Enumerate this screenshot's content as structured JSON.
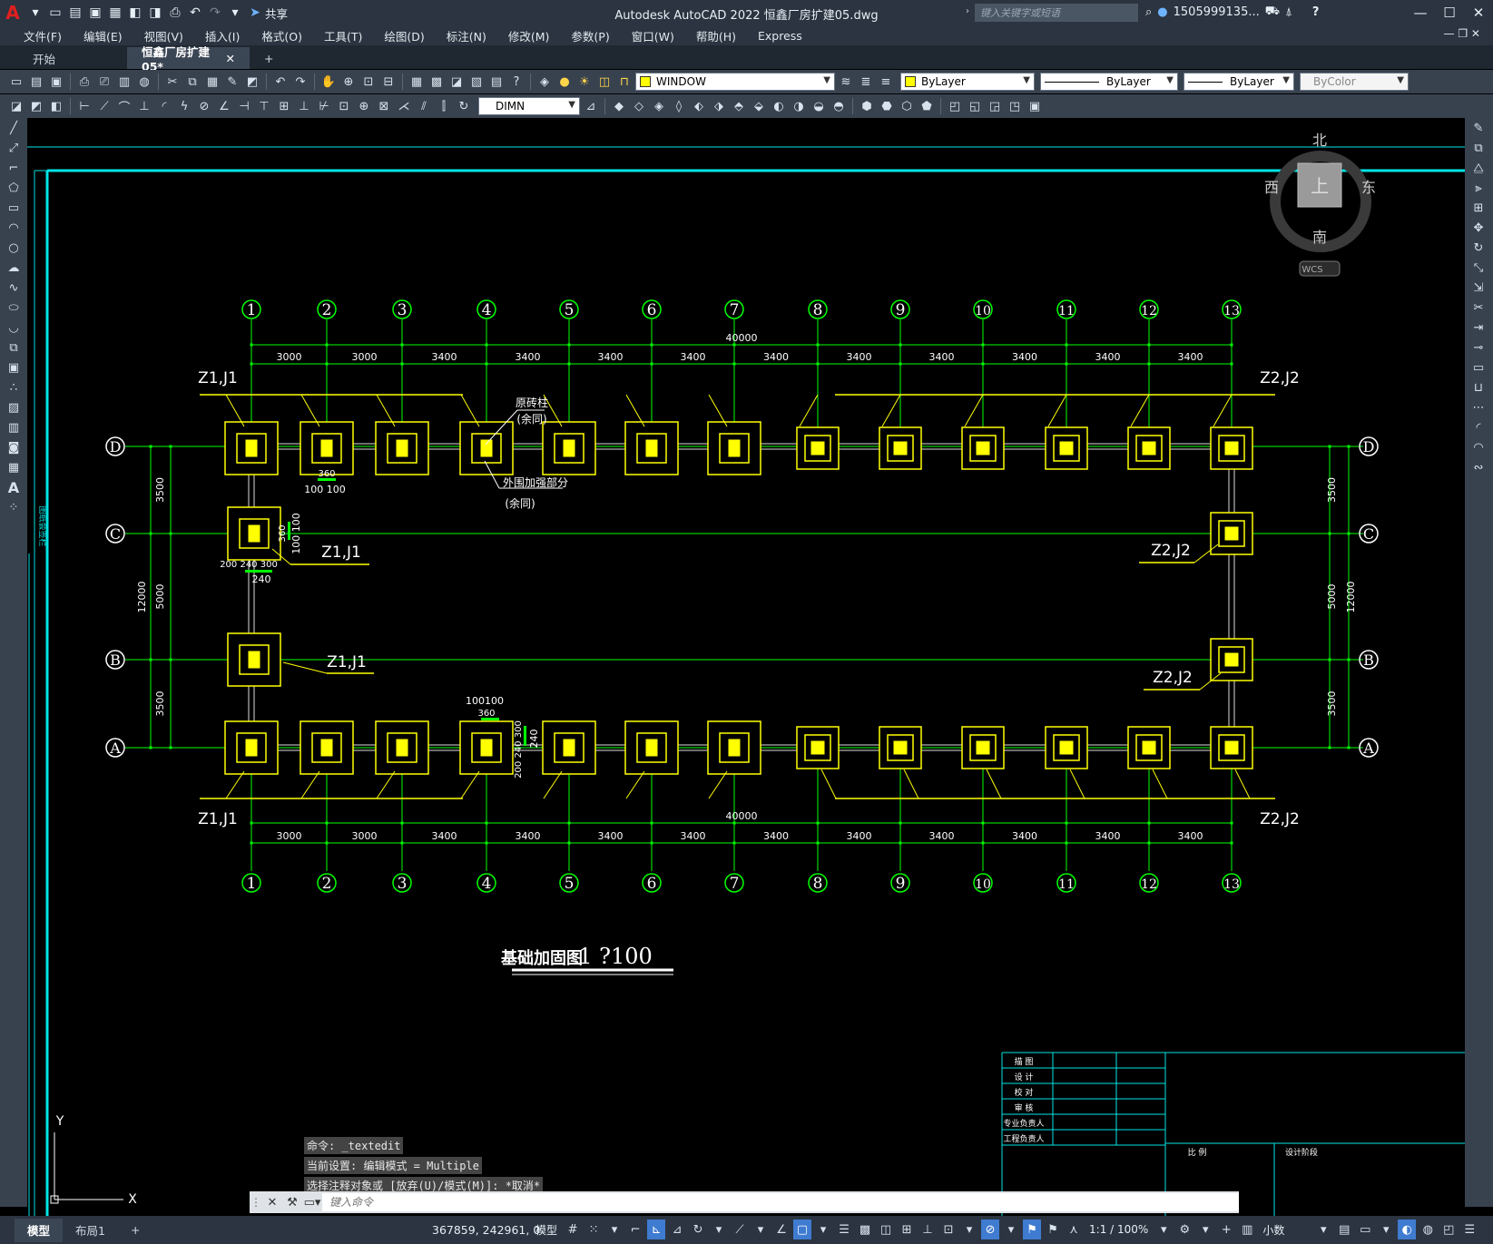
{
  "app": {
    "logo": "A",
    "title": "Autodesk AutoCAD 2022    恒鑫厂房扩建05.dwg",
    "share_label": "共享",
    "search_placeholder": "键入关键字或短语",
    "user": "1505999135...",
    "help": "?"
  },
  "menu": [
    "文件(F)",
    "编辑(E)",
    "视图(V)",
    "插入(I)",
    "格式(O)",
    "工具(T)",
    "绘图(D)",
    "标注(N)",
    "修改(M)",
    "参数(P)",
    "窗口(W)",
    "帮助(H)",
    "Express"
  ],
  "tabs": [
    {
      "label": "开始"
    },
    {
      "label": "恒鑫厂房扩建05*"
    }
  ],
  "toolbar": {
    "view_combo": "WINDOW",
    "color_combo": "ByLayer",
    "linetype_combo": "ByLayer",
    "lineweight_combo": "ByLayer",
    "plotstyle_combo": "ByColor",
    "dimstyle_combo": "DIMN"
  },
  "viewcube": {
    "north": "北",
    "south": "南",
    "east": "东",
    "west": "西",
    "top": "上",
    "wcs": "WCS"
  },
  "drawing": {
    "colors": {
      "grid": "#00ff00",
      "footing": "#ffff00",
      "frame": "#00e5e5",
      "text": "#ffffff"
    },
    "col_axes": [
      "1",
      "2",
      "3",
      "4",
      "5",
      "6",
      "7",
      "8",
      "9",
      "10",
      "11",
      "12",
      "13"
    ],
    "row_axes": [
      "D",
      "C",
      "B",
      "A"
    ],
    "bay_dims": [
      "3000",
      "3000",
      "3400",
      "3400",
      "3400",
      "3400",
      "3400",
      "3400",
      "3400",
      "3400",
      "3400",
      "3400"
    ],
    "total_dim": "40000",
    "side_dims": [
      "3500",
      "5000",
      "3500"
    ],
    "side_total": "12000",
    "labels": {
      "z1j1": "Z1,J1",
      "z2j2": "Z2,J2",
      "brick_col": "原砖柱",
      "same": "(余同)",
      "outer_reinf": "外围加强部分",
      "title": "基础加固图",
      "scale": "1 ?100"
    },
    "detail_dims": {
      "d360": "360",
      "d100_100": "100  100",
      "d100100": "100100",
      "d200_240_300": "200 240  300",
      "d240": "240",
      "d300": "300",
      "d360v": "360",
      "d100v": "100 100"
    },
    "title_block": [
      "描  图",
      "设  计",
      "校  对",
      "审  核",
      "专业负责人",
      "工程负责人"
    ],
    "title_block_extra": [
      "比  例",
      "设计阶段"
    ],
    "left_stamp": "图纸会签栏",
    "ucs": {
      "y": "Y",
      "x": "X"
    }
  },
  "command": {
    "history": [
      "命令: _textedit",
      "当前设置: 编辑模式 = Multiple",
      "选择注释对象或 [放弃(U)/模式(M)]: *取消*"
    ],
    "placeholder": "键入命令"
  },
  "status": {
    "layouts": [
      "模型",
      "布局1"
    ],
    "coords": "367859, 242961, 0",
    "model": "模型",
    "scale": "1:1 / 100%",
    "units": "小数"
  }
}
